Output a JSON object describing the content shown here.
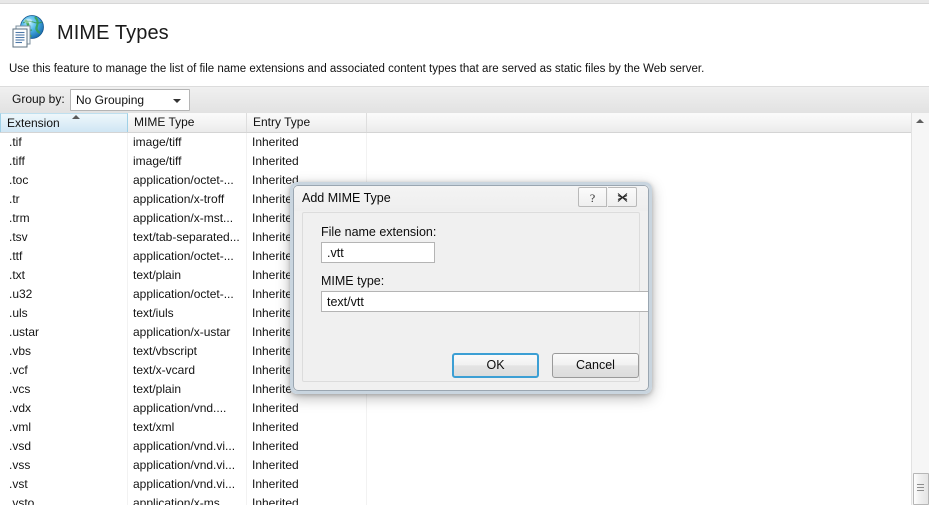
{
  "page": {
    "icon": "mime-types-globe-document-icon",
    "title": "MIME Types",
    "description": "Use this feature to manage the list of file name extensions and associated content types that are served as static files by the Web server."
  },
  "toolbar": {
    "group_by_label": "Group by:",
    "group_by_value": "No Grouping",
    "group_by_arrow_icon": "chevron-down-icon"
  },
  "list": {
    "columns": [
      {
        "key": "extension",
        "label": "Extension",
        "sorted": true,
        "sort_dir": "asc"
      },
      {
        "key": "mime_type",
        "label": "MIME Type",
        "sorted": false
      },
      {
        "key": "entry_type",
        "label": "Entry Type",
        "sorted": false
      },
      {
        "key": "spacer",
        "label": "",
        "sorted": false
      }
    ],
    "rows": [
      {
        "extension": ".tif",
        "mime_type": "image/tiff",
        "entry_type": "Inherited"
      },
      {
        "extension": ".tiff",
        "mime_type": "image/tiff",
        "entry_type": "Inherited"
      },
      {
        "extension": ".toc",
        "mime_type": "application/octet-...",
        "entry_type": "Inherited"
      },
      {
        "extension": ".tr",
        "mime_type": "application/x-troff",
        "entry_type": "Inherited"
      },
      {
        "extension": ".trm",
        "mime_type": "application/x-mst...",
        "entry_type": "Inherited"
      },
      {
        "extension": ".tsv",
        "mime_type": "text/tab-separated...",
        "entry_type": "Inherited"
      },
      {
        "extension": ".ttf",
        "mime_type": "application/octet-...",
        "entry_type": "Inherited"
      },
      {
        "extension": ".txt",
        "mime_type": "text/plain",
        "entry_type": "Inherited"
      },
      {
        "extension": ".u32",
        "mime_type": "application/octet-...",
        "entry_type": "Inherited"
      },
      {
        "extension": ".uls",
        "mime_type": "text/iuls",
        "entry_type": "Inherited"
      },
      {
        "extension": ".ustar",
        "mime_type": "application/x-ustar",
        "entry_type": "Inherited"
      },
      {
        "extension": ".vbs",
        "mime_type": "text/vbscript",
        "entry_type": "Inherited"
      },
      {
        "extension": ".vcf",
        "mime_type": "text/x-vcard",
        "entry_type": "Inherited"
      },
      {
        "extension": ".vcs",
        "mime_type": "text/plain",
        "entry_type": "Inherited"
      },
      {
        "extension": ".vdx",
        "mime_type": "application/vnd....",
        "entry_type": "Inherited"
      },
      {
        "extension": ".vml",
        "mime_type": "text/xml",
        "entry_type": "Inherited"
      },
      {
        "extension": ".vsd",
        "mime_type": "application/vnd.vi...",
        "entry_type": "Inherited"
      },
      {
        "extension": ".vss",
        "mime_type": "application/vnd.vi...",
        "entry_type": "Inherited"
      },
      {
        "extension": ".vst",
        "mime_type": "application/vnd.vi...",
        "entry_type": "Inherited"
      },
      {
        "extension": ".vsto",
        "mime_type": "application/x-ms...",
        "entry_type": "Inherited"
      }
    ]
  },
  "scrollbar": {
    "up_arrow_icon": "scroll-up-arrow-icon",
    "thumb_icon": "scroll-thumb-grip-icon"
  },
  "dialog": {
    "title": "Add MIME Type",
    "help_button_icon": "help-question-icon",
    "close_button_icon": "close-x-icon",
    "extension_label": "File name extension:",
    "extension_value": ".vtt",
    "mime_type_label": "MIME type:",
    "mime_type_value": "text/vtt",
    "ok_label": "OK",
    "cancel_label": "Cancel"
  },
  "colors": {
    "accent_focus": "#3c9fd4",
    "sorted_column": "#dcedf7",
    "toolbar_bg": "#e9e9e9",
    "dialog_bg": "#f0f0f0"
  }
}
